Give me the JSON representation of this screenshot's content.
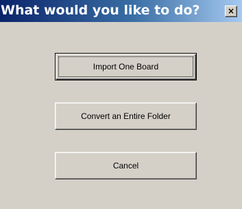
{
  "dialog": {
    "title": "What would you like to do?",
    "close_glyph": "×",
    "buttons": {
      "import_one": "Import One Board",
      "convert_folder": "Convert an Entire Folder",
      "cancel": "Cancel"
    },
    "colors": {
      "titlebar_start": "#0a246a",
      "titlebar_end": "#a6caf0",
      "face": "#d4d0c8"
    }
  }
}
